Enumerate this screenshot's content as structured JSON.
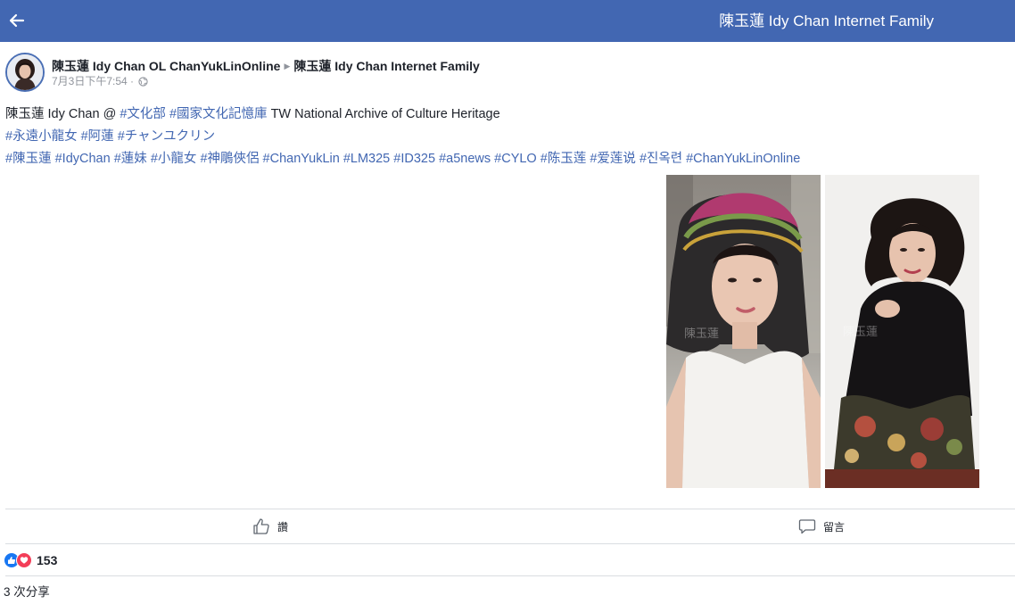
{
  "topbar": {
    "back_icon": "back-arrow-icon",
    "title": "陳玉蓮 Idy Chan Internet Family",
    "color": "#4267b2"
  },
  "post": {
    "author": "陳玉蓮 Idy Chan OL ChanYukLinOnline",
    "separator_icon": "triangle-right-icon",
    "group": "陳玉蓮 Idy Chan Internet Family",
    "timestamp": "7月3日下午7:54 ·",
    "privacy_icon": "globe-icon",
    "text": {
      "line1_prefix": "陳玉蓮 Idy Chan @",
      "line1_tags": [
        "#文化部",
        "#國家文化記憶庫"
      ],
      "line1_suffix": "TW National Archive of Culture Heritage",
      "line2_tags": [
        "#永遠小龍女",
        "#阿蓮",
        "#チャンユクリン"
      ],
      "line3_tags": [
        "#陳玉蓮",
        "#IdyChan",
        "#蓮妹",
        "#小龍女",
        "#神鵰俠侶",
        "#ChanYukLin",
        "#LM325",
        "#ID325",
        "#a5news",
        "#CYLO",
        "#陈玉莲",
        "#爱莲说",
        "#진옥련",
        "#ChanYukLinOnline"
      ]
    },
    "link_color": "#4267b2"
  },
  "actions": {
    "like_label": "讚",
    "like_icon": "thumbs-up-icon",
    "comment_label": "留言",
    "comment_icon": "speech-bubble-icon"
  },
  "reactions": {
    "icons": [
      "like-reaction-icon",
      "love-reaction-icon"
    ],
    "count": "153"
  },
  "shares": {
    "text": "3 次分享"
  }
}
